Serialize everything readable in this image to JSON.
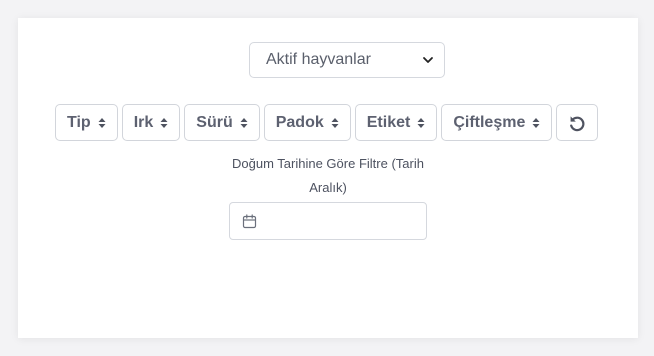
{
  "status_select": {
    "selected": "Aktif hayvanlar",
    "icon": "chevron-down-icon"
  },
  "filters": [
    {
      "key": "tip",
      "label": "Tip"
    },
    {
      "key": "irk",
      "label": "Irk"
    },
    {
      "key": "suru",
      "label": "Sürü"
    },
    {
      "key": "padok",
      "label": "Padok"
    },
    {
      "key": "etiket",
      "label": "Etiket"
    },
    {
      "key": "ciftlesme",
      "label": "Çiftleşme"
    }
  ],
  "reset_icon": "undo-icon",
  "date_filter": {
    "label": "Doğum Tarihine Göre Filtre (Tarih Aralık)",
    "value": "",
    "icon": "calendar-icon"
  }
}
